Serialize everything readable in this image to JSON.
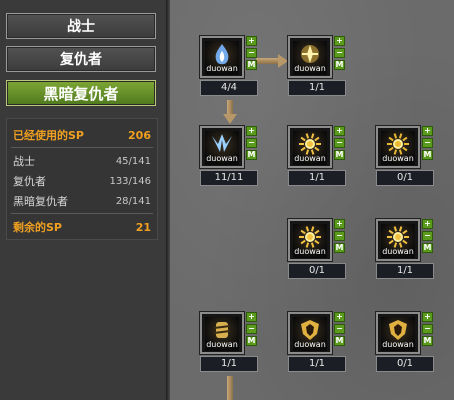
{
  "classes": [
    {
      "label": "战士",
      "active": false
    },
    {
      "label": "复仇者",
      "active": false
    },
    {
      "label": "黑暗复仇者",
      "active": true
    }
  ],
  "sp": {
    "used_label": "已经使用的SP",
    "used_value": "206",
    "rows": [
      {
        "label": "战士",
        "value": "45/141"
      },
      {
        "label": "复仇者",
        "value": "133/146"
      },
      {
        "label": "黑暗复仇者",
        "value": "28/141"
      }
    ],
    "remaining_label": "剩余的SP",
    "remaining_value": "21"
  },
  "skill_brand": "duowan",
  "buttons": {
    "plus": "+",
    "minus": "−",
    "master": "M"
  },
  "skills": [
    {
      "id": "s1",
      "count": "4/4",
      "icon": "blue-flame-icon",
      "accent": "#7ab8ff"
    },
    {
      "id": "s2",
      "count": "1/1",
      "icon": "gold-claw-icon",
      "accent": "#f0c040"
    },
    {
      "id": "s3",
      "count": "11/11",
      "icon": "blue-wing-icon",
      "accent": "#9ad0ff"
    },
    {
      "id": "s4",
      "count": "1/1",
      "icon": "gold-sun-icon",
      "accent": "#f0c040"
    },
    {
      "id": "s5",
      "count": "0/1",
      "icon": "gold-sun-icon",
      "accent": "#e8b830"
    },
    {
      "id": "s6",
      "count": "0/1",
      "icon": "gold-sun-icon",
      "accent": "#f0c040"
    },
    {
      "id": "s7",
      "count": "1/1",
      "icon": "gold-sun-icon",
      "accent": "#f0c040"
    },
    {
      "id": "s8",
      "count": "1/1",
      "icon": "gold-glove-icon",
      "accent": "#d8b050"
    },
    {
      "id": "s9",
      "count": "1/1",
      "icon": "gold-shield-icon",
      "accent": "#e0b040"
    },
    {
      "id": "s10",
      "count": "0/1",
      "icon": "gold-shield-icon",
      "accent": "#e0b040"
    }
  ],
  "colors": {
    "active_class": "#6a9a2c",
    "sp_highlight": "#f0a020",
    "button_green": "#5a9a1c"
  }
}
